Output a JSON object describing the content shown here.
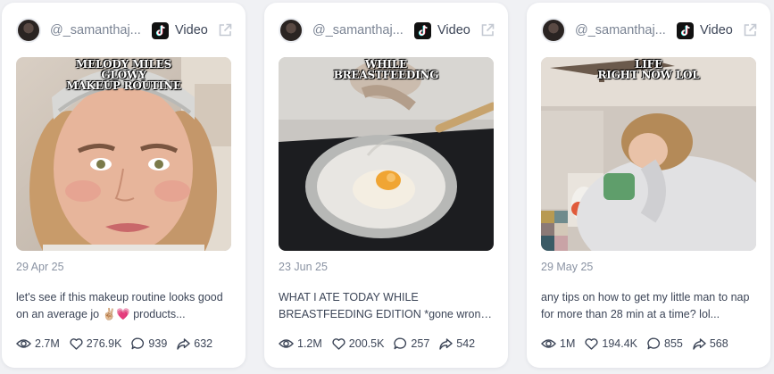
{
  "colors": {
    "accent_pink": "#e8437d",
    "text": "#3c4557",
    "muted": "#8a93a3"
  },
  "cards": [
    {
      "username": "@_samanthaj...",
      "platform_icon": "tiktok-icon",
      "type": "Video",
      "overlay": "MELODY MILES\nGLOWY\nMAKEUP ROUTINE",
      "date": "29 Apr 25",
      "caption": "let's see if this makeup routine looks good on an average jo ✌🏼💗 products...",
      "stats": {
        "views": "2.7M",
        "likes": "276.9K",
        "comments": "939",
        "shares": "632"
      }
    },
    {
      "username": "@_samanthaj...",
      "platform_icon": "tiktok-icon",
      "type": "Video",
      "overlay": "WHILE\nBREASTFEEDING",
      "date": "23 Jun 25",
      "caption": "WHAT I ATE TODAY WHILE BREASTFEEDING EDITION *gone wrong bc we all got supe...",
      "stats": {
        "views": "1.2M",
        "likes": "200.5K",
        "comments": "257",
        "shares": "542"
      }
    },
    {
      "username": "@_samanthaj...",
      "platform_icon": "tiktok-icon",
      "type": "Video",
      "overlay": "LIFE\nRIGHT NOW LOL",
      "date": "29 May 25",
      "caption": "any tips on how to get my little man to nap for more than 28 min at a time? lol...",
      "stats": {
        "views": "1M",
        "likes": "194.4K",
        "comments": "855",
        "shares": "568"
      }
    }
  ]
}
